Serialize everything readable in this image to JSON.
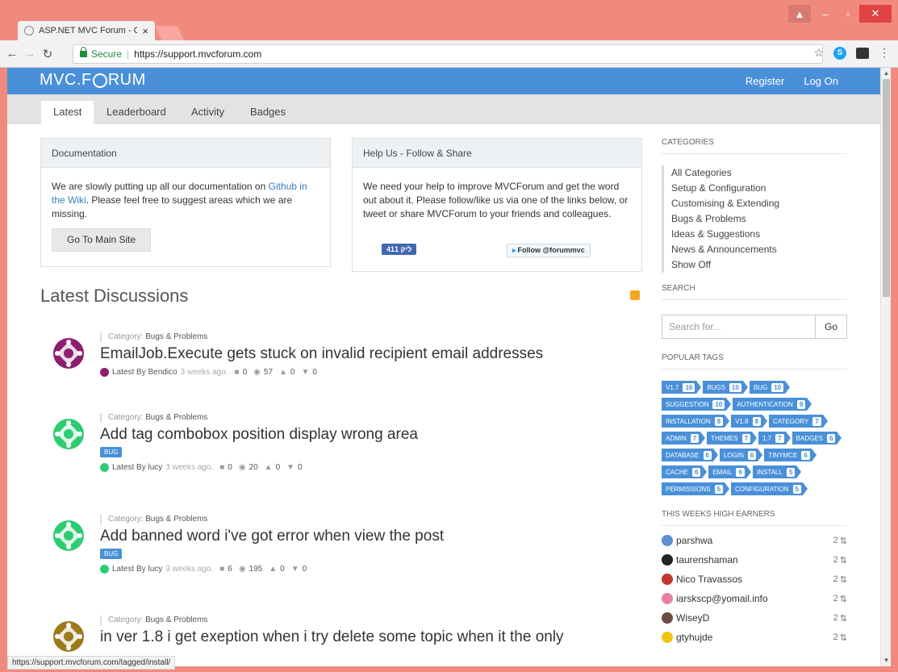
{
  "browser": {
    "tab_title": "ASP.NET MVC Forum - C",
    "secure_label": "Secure",
    "url": "https://support.mvcforum.com",
    "status_url": "https://support.mvcforum.com/tagged/install/"
  },
  "site": {
    "logo_left": "MVC.F",
    "logo_right": "RUM",
    "register": "Register",
    "login": "Log On",
    "tabs": [
      "Latest",
      "Leaderboard",
      "Activity",
      "Badges"
    ]
  },
  "doc_panel": {
    "title": "Documentation",
    "text_1": "We are slowly putting up all our documentation on ",
    "link": "Github in the Wiki",
    "text_2": ". Please feel free to suggest areas which we are missing.",
    "button": "Go To Main Site"
  },
  "help_panel": {
    "title": "Help Us - Follow & Share",
    "text": "We need your help to improve MVCForum and get the word out about it. Please follow/like us via one of the links below, or tweet or share MVCForum to your friends and colleagues.",
    "like": "411 ליק",
    "follow": "Follow @forummvc"
  },
  "latest_title": "Latest Discussions",
  "discussions": [
    {
      "category_prefix": "Category:",
      "category": "Bugs & Problems",
      "title": "EmailJob.Execute gets stuck on invalid recipient email addresses",
      "tag": "",
      "author": "Latest By Bendico",
      "ago": "3 weeks ago.",
      "replies": "0",
      "views": "57",
      "up": "0",
      "down": "0",
      "color": "#8e1e6e"
    },
    {
      "category_prefix": "Category:",
      "category": "Bugs & Problems",
      "title": "Add tag combobox position display wrong area",
      "tag": "BUG",
      "author": "Latest By lucy",
      "ago": "3 weeks ago.",
      "replies": "0",
      "views": "20",
      "up": "0",
      "down": "0",
      "color": "#2ecc71"
    },
    {
      "category_prefix": "Category:",
      "category": "Bugs & Problems",
      "title": "Add banned word i've got error when view the post",
      "tag": "BUG",
      "author": "Latest By lucy",
      "ago": "3 weeks ago.",
      "replies": "6",
      "views": "195",
      "up": "0",
      "down": "0",
      "color": "#2ecc71"
    },
    {
      "category_prefix": "Category:",
      "category": "Bugs & Problems",
      "title": "in ver 1.8 i get exeption when i try delete some topic when it the only",
      "tag": "",
      "author": "",
      "ago": "",
      "replies": "",
      "views": "",
      "up": "",
      "down": "",
      "color": "#9b7a1a"
    }
  ],
  "sidebar": {
    "categories_heading": "CATEGORIES",
    "categories": [
      "All Categories",
      "Setup & Configuration",
      "Customising & Extending",
      "Bugs & Problems",
      "Ideas & Suggestions",
      "News & Announcements",
      "Show Off"
    ],
    "search_heading": "SEARCH",
    "search_placeholder": "Search for...",
    "search_button": "Go",
    "tags_heading": "POPULAR TAGS",
    "tags": [
      {
        "name": "V1.7",
        "count": "16"
      },
      {
        "name": "BUGS",
        "count": "10"
      },
      {
        "name": "BUG",
        "count": "10"
      },
      {
        "name": "SUGGESTION",
        "count": "10"
      },
      {
        "name": "AUTHENTICATION",
        "count": "9"
      },
      {
        "name": "INSTALLATION",
        "count": "8"
      },
      {
        "name": "V1.8",
        "count": "8"
      },
      {
        "name": "CATEGORY",
        "count": "7"
      },
      {
        "name": "ADMIN",
        "count": "7"
      },
      {
        "name": "THEMES",
        "count": "7"
      },
      {
        "name": "1.7",
        "count": "7"
      },
      {
        "name": "BADGES",
        "count": "6"
      },
      {
        "name": "DATABASE",
        "count": "6"
      },
      {
        "name": "LOGIN",
        "count": "6"
      },
      {
        "name": "TINYMCE",
        "count": "6"
      },
      {
        "name": "CACHE",
        "count": "6"
      },
      {
        "name": "EMAIL",
        "count": "6"
      },
      {
        "name": "INSTALL",
        "count": "5"
      },
      {
        "name": "PERMISSIONS",
        "count": "5"
      },
      {
        "name": "CONFIGURATION",
        "count": "5"
      }
    ],
    "earners_heading": "THIS WEEKS HIGH EARNERS",
    "earners": [
      {
        "name": "parshwa",
        "points": "2",
        "color": "#5b8fd1"
      },
      {
        "name": "taurenshaman",
        "points": "2",
        "color": "#222222"
      },
      {
        "name": "Nico Travassos",
        "points": "2",
        "color": "#c0392b"
      },
      {
        "name": "iarskscp@yomail.info",
        "points": "2",
        "color": "#e87fa0"
      },
      {
        "name": "WiseyD",
        "points": "2",
        "color": "#6d4c41"
      },
      {
        "name": "gtyhujde",
        "points": "2",
        "color": "#f1c40f"
      }
    ]
  }
}
